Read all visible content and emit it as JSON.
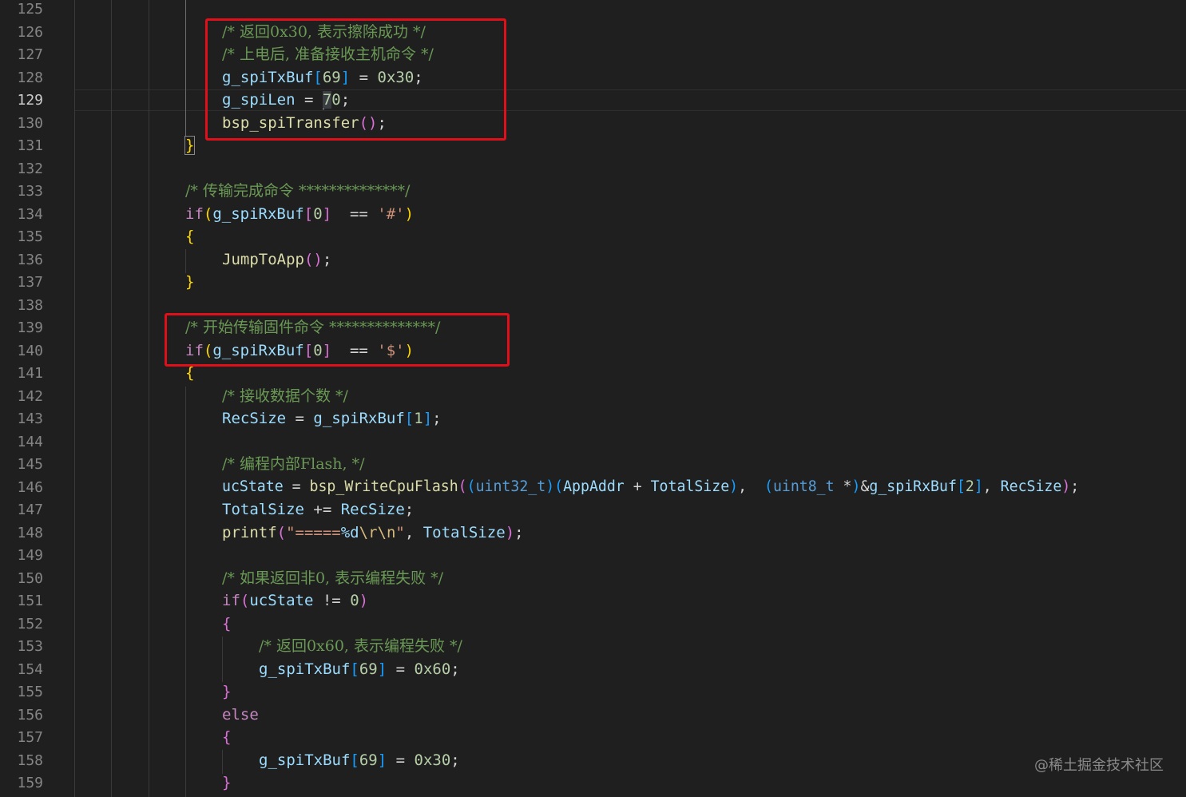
{
  "editor": {
    "current_line": 129,
    "line_numbers": [
      "125",
      "126",
      "127",
      "128",
      "129",
      "130",
      "131",
      "132",
      "133",
      "134",
      "135",
      "136",
      "137",
      "138",
      "139",
      "140",
      "141",
      "142",
      "143",
      "144",
      "145",
      "146",
      "147",
      "148",
      "149",
      "150",
      "151",
      "152",
      "153",
      "154",
      "155",
      "156",
      "157",
      "158",
      "159"
    ],
    "lines": {
      "l126": {
        "comment": "/* 返回0x30, 表示擦除成功 */"
      },
      "l127": {
        "comment": "/* 上电后, 准备接收主机命令 */"
      },
      "l128": {
        "var": "g_spiTxBuf",
        "open": "[",
        "idx": "69",
        "close": "]",
        "op": " = ",
        "val": "0x30",
        "end": ";"
      },
      "l129": {
        "var": "g_spiLen",
        "op": " = ",
        "val_a": "7",
        "val_b": "0",
        "end": ";"
      },
      "l130": {
        "fn": "bsp_spiTransfer",
        "parens": "()",
        "end": ";"
      },
      "l131": {
        "brace": "}"
      },
      "l133": {
        "comment": "/* 传输完成命令 **************/"
      },
      "l134": {
        "kw": "if",
        "open": "(",
        "var": "g_spiRxBuf",
        "bo": "[",
        "idx": "0",
        "bc": "]",
        "op": "  == ",
        "str": "'#'",
        "close": ")"
      },
      "l135": {
        "brace": "{"
      },
      "l136": {
        "fn": "JumpToApp",
        "parens": "()",
        "end": ";"
      },
      "l137": {
        "brace": "}"
      },
      "l139": {
        "comment": "/* 开始传输固件命令 **************/"
      },
      "l140": {
        "kw": "if",
        "open": "(",
        "var": "g_spiRxBuf",
        "bo": "[",
        "idx": "0",
        "bc": "]",
        "op": "  == ",
        "str": "'$'",
        "close": ")"
      },
      "l141": {
        "brace": "{"
      },
      "l142": {
        "comment": "/* 接收数据个数 */"
      },
      "l143": {
        "var1": "RecSize",
        "op": " = ",
        "var2": "g_spiRxBuf",
        "bo": "[",
        "idx": "1",
        "bc": "]",
        "end": ";"
      },
      "l145": {
        "comment": "/* 编程内部Flash, */"
      },
      "l146": {
        "var1": "ucState",
        "op": " = ",
        "fn": "bsp_WriteCpuFlash",
        "p1": "(",
        "p2": "(",
        "type1": "uint32_t",
        "p3": ")",
        "p4": "(",
        "var2": "AppAddr",
        "plus": " + ",
        "var3": "TotalSize",
        "p5": ")",
        "comma": ",  ",
        "p6": "(",
        "type2": "uint8_t",
        "star": " *",
        "p7": ")",
        "amp": "&",
        "var4": "g_spiRxBuf",
        "bo": "[",
        "idx": "2",
        "bc": "]",
        "comma2": ", ",
        "var5": "RecSize",
        "p8": ")",
        "end": ";"
      },
      "l147": {
        "var1": "TotalSize",
        "op": " += ",
        "var2": "RecSize",
        "end": ";"
      },
      "l148": {
        "fn": "printf",
        "open": "(",
        "str1": "\"=====",
        "fmt": "%d",
        "esc": "\\r\\n",
        "str2": "\"",
        "comma": ", ",
        "var": "TotalSize",
        "close": ")",
        "end": ";"
      },
      "l150": {
        "comment": "/* 如果返回非0, 表示编程失败 */"
      },
      "l151": {
        "kw": "if",
        "open": "(",
        "var": "ucState",
        "op": " != ",
        "val": "0",
        "close": ")"
      },
      "l152": {
        "brace": "{"
      },
      "l153": {
        "comment": "/* 返回0x60, 表示编程失败 */"
      },
      "l154": {
        "var": "g_spiTxBuf",
        "open": "[",
        "idx": "69",
        "close": "]",
        "op": " = ",
        "val": "0x60",
        "end": ";"
      },
      "l155": {
        "brace": "}"
      },
      "l156": {
        "kw": "else"
      },
      "l157": {
        "brace": "{"
      },
      "l158": {
        "var": "g_spiTxBuf",
        "open": "[",
        "idx": "69",
        "close": "]",
        "op": " = ",
        "val": "0x30",
        "end": ";"
      },
      "l159": {
        "brace": "}"
      }
    }
  },
  "watermark": "@稀土掘金技术社区",
  "colors": {
    "background": "#1f1f1f",
    "highlight_box": "#e0101a",
    "comment": "#6a9955",
    "variable": "#9cdcfe",
    "function": "#dcdcaa",
    "number": "#b5cea8",
    "string": "#ce9178",
    "keyword_control": "#c586c0",
    "type": "#569cd6"
  }
}
